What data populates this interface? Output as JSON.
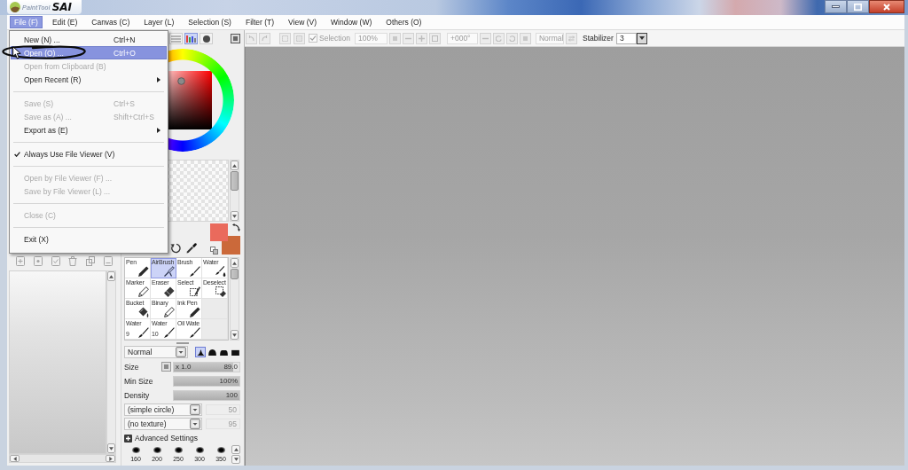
{
  "title_bar": {
    "app_name_small": "PaintTool",
    "app_name_large": "SAI"
  },
  "menu_bar": [
    {
      "label": "File (F)",
      "selected": true
    },
    {
      "label": "Edit (E)",
      "selected": false
    },
    {
      "label": "Canvas (C)",
      "selected": false
    },
    {
      "label": "Layer (L)",
      "selected": false
    },
    {
      "label": "Selection (S)",
      "selected": false
    },
    {
      "label": "Filter (T)",
      "selected": false
    },
    {
      "label": "View (V)",
      "selected": false
    },
    {
      "label": "Window (W)",
      "selected": false
    },
    {
      "label": "Others (O)",
      "selected": false
    }
  ],
  "file_menu": [
    {
      "kind": "command",
      "label": "New (N) ...",
      "shortcut": "Ctrl+N",
      "disabled": false,
      "selected": false
    },
    {
      "kind": "command",
      "label": "Open (O) ...",
      "shortcut": "Ctrl+O",
      "disabled": false,
      "selected": true
    },
    {
      "kind": "command",
      "label": "Open from Clipboard (B)",
      "disabled": true,
      "selected": false
    },
    {
      "kind": "submenu",
      "label": "Open Recent (R)",
      "disabled": false,
      "selected": false
    },
    {
      "kind": "separator"
    },
    {
      "kind": "command",
      "label": "Save (S)",
      "shortcut": "Ctrl+S",
      "disabled": true,
      "selected": false
    },
    {
      "kind": "command",
      "label": "Save as (A) ...",
      "shortcut": "Shift+Ctrl+S",
      "disabled": true,
      "selected": false
    },
    {
      "kind": "submenu",
      "label": "Export as (E)",
      "disabled": false,
      "selected": false
    },
    {
      "kind": "separator"
    },
    {
      "kind": "toggle",
      "label": "Always Use File Viewer (V)",
      "checked": true,
      "disabled": false,
      "selected": false
    },
    {
      "kind": "separator"
    },
    {
      "kind": "command",
      "label": "Open by File Viewer (F) ...",
      "disabled": true,
      "selected": false
    },
    {
      "kind": "command",
      "label": "Save by File Viewer (L) ...",
      "disabled": true,
      "selected": false
    },
    {
      "kind": "separator"
    },
    {
      "kind": "command",
      "label": "Close (C)",
      "disabled": true,
      "selected": false
    },
    {
      "kind": "separator"
    },
    {
      "kind": "command",
      "label": "Exit (X)",
      "disabled": false,
      "selected": false
    }
  ],
  "toolbar": {
    "selection": {
      "label": "Selection",
      "checked": true,
      "disabled": true
    },
    "zoom": {
      "value": "100%",
      "disabled": true
    },
    "rotation": {
      "value": "+000°",
      "disabled": true
    },
    "blend_mode": {
      "value": "Normal",
      "disabled": true
    },
    "stabilizer": {
      "label": "Stabilizer",
      "value": "3"
    }
  },
  "color_panel": {
    "modes": [
      {
        "kind": "sliders",
        "selected": false
      },
      {
        "kind": "bars",
        "selected": true
      },
      {
        "kind": "circle",
        "selected": false
      }
    ],
    "colors": [
      {
        "color": "#ea6a5c"
      },
      {
        "color": "#cb693a"
      }
    ]
  },
  "tools": [
    [
      {
        "label": "Pen",
        "kind": "pen",
        "selected": false
      },
      {
        "label": "AirBrush",
        "kind": "airbrush",
        "selected": true
      },
      {
        "label": "Brush",
        "kind": "brush",
        "selected": false
      },
      {
        "label": "Water",
        "kind": "water",
        "selected": false
      }
    ],
    [
      {
        "label": "Marker",
        "kind": "marker",
        "selected": false
      },
      {
        "label": "Eraser",
        "kind": "eraser",
        "selected": false
      },
      {
        "label": "Select",
        "kind": "select",
        "selected": false
      },
      {
        "label": "Deselect",
        "kind": "deselect",
        "selected": false
      }
    ],
    [
      {
        "label": "Bucket",
        "kind": "bucket",
        "selected": false
      },
      {
        "label": "Binary",
        "kind": "binary",
        "selected": false
      },
      {
        "label": "Ink Pen",
        "kind": "pen",
        "selected": false
      }
    ],
    [
      {
        "label": "Water",
        "number": "9",
        "kind": "brush",
        "selected": false
      },
      {
        "label": "Water",
        "number": "10",
        "kind": "brush",
        "selected": false
      },
      {
        "label": "Oil Wate",
        "kind": "brush",
        "selected": false
      }
    ]
  ],
  "brush": {
    "blend_mode": "Normal",
    "shapes": [
      {
        "kind": "sharp",
        "selected": true
      },
      {
        "kind": "round",
        "selected": false
      },
      {
        "kind": "flat",
        "selected": false
      },
      {
        "kind": "square",
        "selected": false
      }
    ],
    "sliders": [
      {
        "label": "Size",
        "multiplier": "x 1.0",
        "reading": "89.0",
        "level": 0.9
      },
      {
        "label": "Min Size",
        "reading": "100%",
        "level": 1
      },
      {
        "label": "Density",
        "reading": "100",
        "level": 1
      }
    ],
    "textures": [
      {
        "value": "(simple circle)",
        "reading": "50",
        "disabled": true
      },
      {
        "value": "(no texture)",
        "reading": "95",
        "disabled": true
      }
    ],
    "advanced": {
      "label": "Advanced Settings",
      "expanded": false
    },
    "sizes": [
      "160",
      "200",
      "250",
      "300",
      "350"
    ]
  }
}
